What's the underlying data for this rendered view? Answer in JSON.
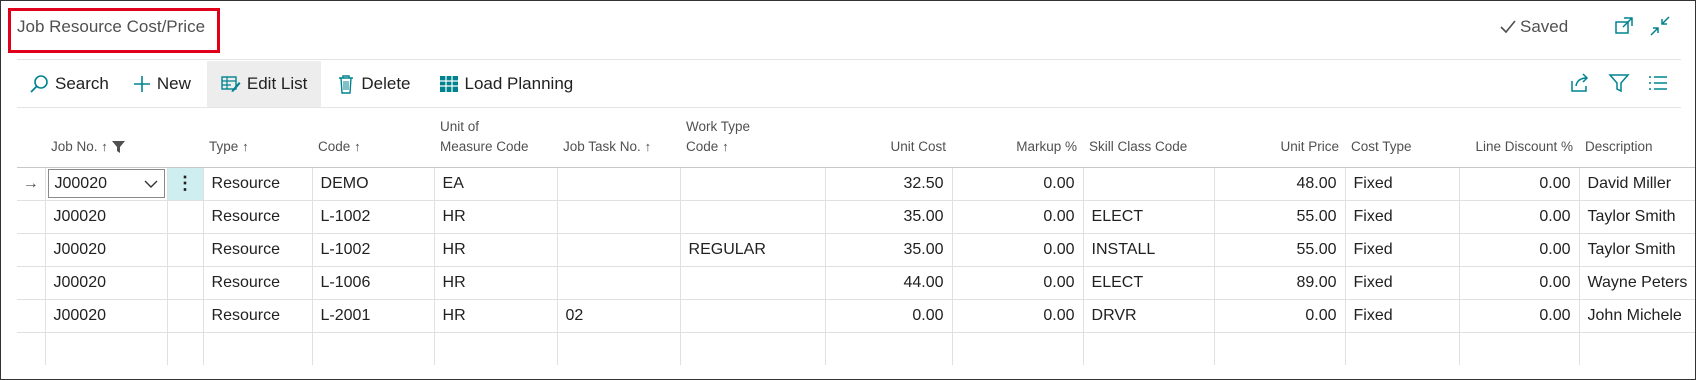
{
  "header": {
    "title": "Job Resource Cost/Price",
    "saved_label": "Saved"
  },
  "toolbar": {
    "search_label": "Search",
    "new_label": "New",
    "edit_list_label": "Edit List",
    "delete_label": "Delete",
    "load_planning_label": "Load Planning"
  },
  "columns": {
    "job_no": "Job No.",
    "type": "Type",
    "code": "Code",
    "uom_line1": "Unit of",
    "uom_line2": "Measure Code",
    "job_task": "Job Task No.",
    "work_type_line1": "Work Type",
    "work_type_line2": "Code",
    "unit_cost": "Unit Cost",
    "markup": "Markup %",
    "skill": "Skill Class Code",
    "unit_price": "Unit Price",
    "cost_type": "Cost Type",
    "line_discount": "Line Discount %",
    "description": "Description"
  },
  "rows": [
    {
      "job_no": "J00020",
      "type": "Resource",
      "code": "DEMO",
      "uom": "EA",
      "job_task": "",
      "work_type": "",
      "unit_cost": "32.50",
      "markup": "0.00",
      "skill": "",
      "unit_price": "48.00",
      "cost_type": "Fixed",
      "line_discount": "0.00",
      "description": "David Miller"
    },
    {
      "job_no": "J00020",
      "type": "Resource",
      "code": "L-1002",
      "uom": "HR",
      "job_task": "",
      "work_type": "",
      "unit_cost": "35.00",
      "markup": "0.00",
      "skill": "ELECT",
      "unit_price": "55.00",
      "cost_type": "Fixed",
      "line_discount": "0.00",
      "description": "Taylor Smith"
    },
    {
      "job_no": "J00020",
      "type": "Resource",
      "code": "L-1002",
      "uom": "HR",
      "job_task": "",
      "work_type": "REGULAR",
      "unit_cost": "35.00",
      "markup": "0.00",
      "skill": "INSTALL",
      "unit_price": "55.00",
      "cost_type": "Fixed",
      "line_discount": "0.00",
      "description": "Taylor Smith"
    },
    {
      "job_no": "J00020",
      "type": "Resource",
      "code": "L-1006",
      "uom": "HR",
      "job_task": "",
      "work_type": "",
      "unit_cost": "44.00",
      "markup": "0.00",
      "skill": "ELECT",
      "unit_price": "89.00",
      "cost_type": "Fixed",
      "line_discount": "0.00",
      "description": "Wayne Peters"
    },
    {
      "job_no": "J00020",
      "type": "Resource",
      "code": "L-2001",
      "uom": "HR",
      "job_task": "02",
      "work_type": "",
      "unit_cost": "0.00",
      "markup": "0.00",
      "skill": "DRVR",
      "unit_price": "0.00",
      "cost_type": "Fixed",
      "line_discount": "0.00",
      "description": "John Michele"
    }
  ],
  "colors": {
    "accent": "#00838f",
    "highlight": "#cfeef0",
    "title_box": "#e0001b"
  }
}
